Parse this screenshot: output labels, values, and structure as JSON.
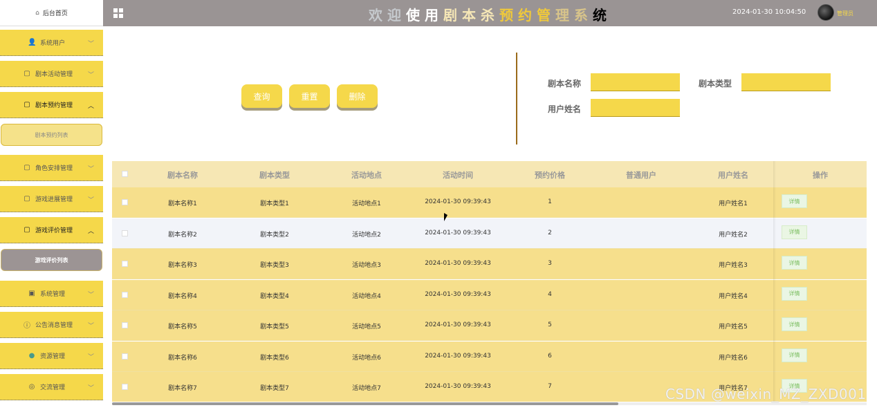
{
  "app": {
    "title_chars": [
      "欢",
      "迎",
      "使",
      "用",
      "剧",
      "本",
      "杀",
      "预",
      "约",
      "管",
      "理",
      "系",
      "统"
    ],
    "datetime": "2024-01-30 10:04:50",
    "user_name": "管理员"
  },
  "sidebar": {
    "home_label": "后台首页",
    "items": [
      {
        "label": "系统用户",
        "icon": "user-icon",
        "expanded": false
      },
      {
        "label": "剧本活动管理",
        "icon": "doc-icon",
        "expanded": false
      },
      {
        "label": "剧本预约管理",
        "icon": "doc-icon",
        "expanded": true,
        "sub": "剧本预约列表"
      },
      {
        "label": "角色安排管理",
        "icon": "doc-icon",
        "expanded": false
      },
      {
        "label": "游戏进展管理",
        "icon": "doc-icon",
        "expanded": false
      },
      {
        "label": "游戏评价管理",
        "icon": "doc-icon",
        "expanded": true,
        "sub": "游戏评价列表"
      },
      {
        "label": "系统管理",
        "icon": "image-icon",
        "expanded": false
      },
      {
        "label": "公告消息管理",
        "icon": "info-icon",
        "expanded": false
      },
      {
        "label": "资源管理",
        "icon": "location-icon",
        "expanded": false
      },
      {
        "label": "交流管理",
        "icon": "chat-icon",
        "expanded": false
      }
    ]
  },
  "toolbar": {
    "query_label": "查询",
    "reset_label": "重置",
    "delete_label": "删除"
  },
  "filters": {
    "script_name_label": "剧本名称",
    "script_type_label": "剧本类型",
    "user_name_label": "用户姓名",
    "script_name_value": "",
    "script_type_value": "",
    "user_name_value": ""
  },
  "table": {
    "headers": [
      "剧本名称",
      "剧本类型",
      "活动地点",
      "活动时间",
      "预约价格",
      "普通用户",
      "用户姓名",
      "操作"
    ],
    "rows": [
      {
        "name": "剧本名称1",
        "type": "剧本类型1",
        "place": "活动地点1",
        "time": "2024-01-30 09:39:43",
        "price": "1",
        "user": "",
        "uname": "用户姓名1",
        "op": "详情"
      },
      {
        "name": "剧本名称2",
        "type": "剧本类型2",
        "place": "活动地点2",
        "time": "2024-01-30 09:39:43",
        "price": "2",
        "user": "",
        "uname": "用户姓名2",
        "op": "详情"
      },
      {
        "name": "剧本名称3",
        "type": "剧本类型3",
        "place": "活动地点3",
        "time": "2024-01-30 09:39:43",
        "price": "3",
        "user": "",
        "uname": "用户姓名3",
        "op": "详情"
      },
      {
        "name": "剧本名称4",
        "type": "剧本类型4",
        "place": "活动地点4",
        "time": "2024-01-30 09:39:43",
        "price": "4",
        "user": "",
        "uname": "用户姓名4",
        "op": "详情"
      },
      {
        "name": "剧本名称5",
        "type": "剧本类型5",
        "place": "活动地点5",
        "time": "2024-01-30 09:39:43",
        "price": "5",
        "user": "",
        "uname": "用户姓名5",
        "op": "详情"
      },
      {
        "name": "剧本名称6",
        "type": "剧本类型6",
        "place": "活动地点6",
        "time": "2024-01-30 09:39:43",
        "price": "6",
        "user": "",
        "uname": "用户姓名6",
        "op": "详情"
      },
      {
        "name": "剧本名称7",
        "type": "剧本类型7",
        "place": "活动地点7",
        "time": "2024-01-30 09:39:43",
        "price": "7",
        "user": "",
        "uname": "用户姓名7",
        "op": "详情"
      }
    ]
  },
  "watermark": "CSDN @weixin_MZ_ZXD001",
  "colors": {
    "accent": "#f5d84a",
    "topbar": "#9a9494",
    "row_alt": "#f2f4f9",
    "header_bg": "#f6e7b4",
    "op_text": "#7bbd60"
  }
}
